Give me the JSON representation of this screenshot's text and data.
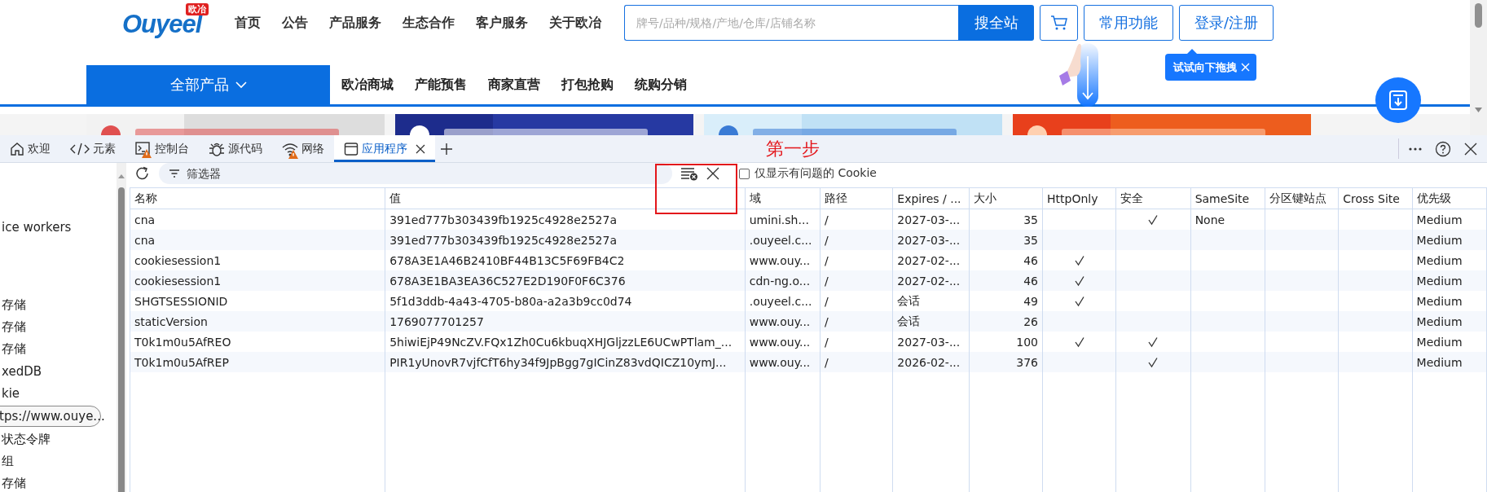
{
  "site": {
    "logo": {
      "brand": "Ouyeel",
      "badge": "欧冶"
    },
    "nav": [
      "首页",
      "公告",
      "产品服务",
      "生态合作",
      "客户服务",
      "关于欧冶"
    ],
    "search": {
      "placeholder": "牌号/品种/规格/产地/仓库/店铺名称",
      "button": "搜全站"
    },
    "buttons": [
      "常用功能",
      "登录/注册"
    ],
    "category_button": "全部产品",
    "sub_nav": [
      "欧冶商城",
      "产能预售",
      "商家直营",
      "打包抢购",
      "统购分销"
    ],
    "tooltip": "试试向下拖拽",
    "banners": [
      {
        "kind": "picture"
      },
      {
        "kind": "picture"
      },
      {
        "kind": "picture"
      },
      {
        "kind": "picture"
      }
    ]
  },
  "devtools": {
    "tabs": [
      {
        "label": "欢迎",
        "warning": false,
        "selected": false
      },
      {
        "label": "元素",
        "warning": false,
        "selected": false
      },
      {
        "label": "控制台",
        "warning": true,
        "selected": false
      },
      {
        "label": "源代码",
        "warning": false,
        "selected": false
      },
      {
        "label": "网络",
        "warning": true,
        "selected": false
      },
      {
        "label": "应用程序",
        "warning": false,
        "selected": true
      }
    ],
    "annotation": "第一步",
    "filter": {
      "placeholder": "筛选器"
    },
    "issues_checkbox": {
      "label": "仅显示有问题的 Cookie",
      "checked": false
    },
    "sidebar": [
      {
        "label": "ice workers",
        "selected": false
      },
      {
        "label": "存储",
        "selected": false
      },
      {
        "label": "存储",
        "selected": false
      },
      {
        "label": "存储",
        "selected": false
      },
      {
        "label": "xedDB",
        "selected": false
      },
      {
        "label": "kie",
        "selected": false
      },
      {
        "label": "tps://www.ouye...",
        "selected": true
      },
      {
        "label": "状态令牌",
        "selected": false
      },
      {
        "label": "组",
        "selected": false
      },
      {
        "label": "存储",
        "selected": false
      }
    ],
    "table": {
      "columns": [
        "名称",
        "值",
        "域",
        "路径",
        "Expires / ...",
        "大小",
        "HttpOnly",
        "安全",
        "SameSite",
        "分区键站点",
        "Cross Site",
        "优先级"
      ],
      "rows": [
        {
          "name": "cna",
          "value": "391ed777b303439fb1925c4928e2527a",
          "domain": "umini.sh...",
          "path": "/",
          "expires": "2027-03-...",
          "size": "35",
          "http_only": false,
          "secure": true,
          "same_site": "None",
          "priority": "Medium"
        },
        {
          "name": "cna",
          "value": "391ed777b303439fb1925c4928e2527a",
          "domain": ".ouyeel.c...",
          "path": "/",
          "expires": "2027-03-...",
          "size": "35",
          "http_only": false,
          "secure": false,
          "priority": "Medium"
        },
        {
          "name": "cookiesession1",
          "value": "678A3E1A46B2410BF44B13C5F69FB4C2",
          "domain": "www.ouy...",
          "path": "/",
          "expires": "2027-02-...",
          "size": "46",
          "http_only": true,
          "secure": false,
          "priority": "Medium"
        },
        {
          "name": "cookiesession1",
          "value": "678A3E1BA3EA36C527E2D190F0F6C376",
          "domain": "cdn-ng.o...",
          "path": "/",
          "expires": "2027-02-...",
          "size": "46",
          "http_only": true,
          "secure": false,
          "priority": "Medium"
        },
        {
          "name": "SHGTSESSIONID",
          "value": "5f1d3ddb-4a43-4705-b80a-a2a3b9cc0d74",
          "domain": ".ouyeel.c...",
          "path": "/",
          "expires": "会话",
          "size": "49",
          "http_only": true,
          "secure": false,
          "priority": "Medium"
        },
        {
          "name": "staticVersion",
          "value": "1769077701257",
          "domain": "www.ouy...",
          "path": "/",
          "expires": "会话",
          "size": "26",
          "http_only": false,
          "secure": false,
          "priority": "Medium"
        },
        {
          "name": "T0k1m0u5AfREO",
          "value": "5hiwiEjP49NcZV.FQx1Zh0Cu6kbuqXHJGljzzLE6UCwPTlam_...",
          "domain": "www.ouy...",
          "path": "/",
          "expires": "2027-03-...",
          "size": "100",
          "http_only": true,
          "secure": true,
          "priority": "Medium"
        },
        {
          "name": "T0k1m0u5AfREP",
          "value": "PIR1yUnovR7vjfCfT6hy34f9JpBgg7gICinZ83vdQICZ10ymJ...",
          "domain": "www.ouy...",
          "path": "/",
          "expires": "2026-02-...",
          "size": "376",
          "http_only": false,
          "secure": true,
          "priority": "Medium"
        }
      ]
    }
  }
}
